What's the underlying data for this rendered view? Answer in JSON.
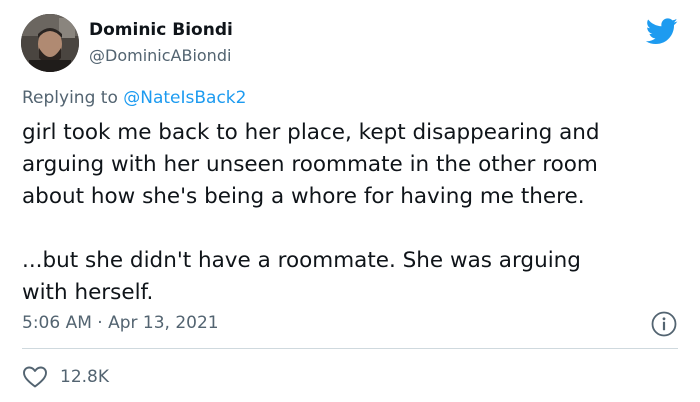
{
  "author": {
    "display_name": "Dominic Biondi",
    "handle": "@DominicABiondi"
  },
  "reply": {
    "prefix": "Replying to ",
    "mention": "@NateIsBack2"
  },
  "tweet": {
    "lines": [
      "girl took me back to her place, kept disappearing and",
      "arguing with her unseen roommate in the other room",
      "about how she's being a whore for having me there.",
      "...but she didn't have a roommate. She was arguing",
      "with herself."
    ],
    "timestamp": "5:06 AM · Apr 13, 2021"
  },
  "stats": {
    "likes": "12.8K"
  },
  "icons": {
    "brand": "twitter-bird-icon",
    "info": "info-icon",
    "like": "heart-icon"
  },
  "colors": {
    "brand_blue": "#1d9bf0",
    "secondary_text": "#536471",
    "primary_text": "#0f1419",
    "divider": "#cfd9de"
  }
}
